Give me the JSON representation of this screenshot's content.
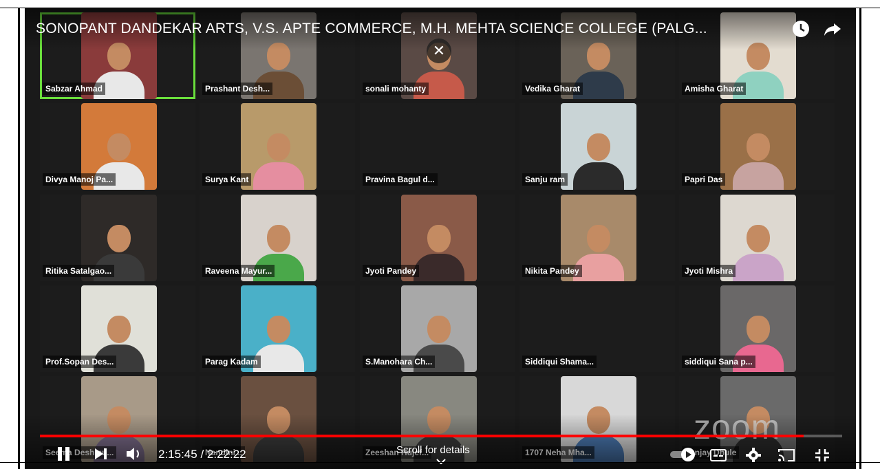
{
  "player": {
    "title": "SONOPANT DANDEKAR ARTS, V.S. APTE COMMERCE, M.H. MEHTA SCIENCE COLLEGE (PALG...",
    "clock_icon": "clock-icon",
    "share_icon": "share-icon",
    "close_icon": "close-icon",
    "watermark": "zoom"
  },
  "participants": [
    {
      "name": "Sabzar Ahmad",
      "active": true,
      "bg": "#8a3b3b",
      "shirt": "#e8e8e8"
    },
    {
      "name": "Prashant Desh...",
      "bg": "#7a7570",
      "shirt": "#6b4e36"
    },
    {
      "name": "sonali mohanty",
      "bg": "#5a4a45",
      "shirt": "#c65a4a"
    },
    {
      "name": "Vedika Gharat",
      "bg": "#6a6258",
      "shirt": "#2e3b4a"
    },
    {
      "name": "Amisha Gharat",
      "bg": "#e3dcd0",
      "shirt": "#8fd1c0"
    },
    {
      "name": "Divya Manoj Pa...",
      "bg": "#d37a3a",
      "shirt": "#e8e8e8"
    },
    {
      "name": "Surya Kant",
      "bg": "#b89a6a",
      "shirt": "#e58ea0"
    },
    {
      "name": "Pravina Bagul d...",
      "bg": "#1c1c1c",
      "shirt": "#1c1c1c"
    },
    {
      "name": "Sanju ram",
      "bg": "#c9d4d6",
      "shirt": "#2b2b2b"
    },
    {
      "name": "Papri Das",
      "bg": "#9a7048",
      "shirt": "#c7a3a0"
    },
    {
      "name": "Ritika Satalgao...",
      "bg": "#2e2a28",
      "shirt": "#3a3a3a"
    },
    {
      "name": "Raveena Mayur...",
      "bg": "#d8d2cc",
      "shirt": "#4aa84a"
    },
    {
      "name": "Jyoti Pandey",
      "bg": "#8a5a48",
      "shirt": "#3a2a2a"
    },
    {
      "name": "Nikita Pandey",
      "bg": "#a88a6a",
      "shirt": "#e8a0a0"
    },
    {
      "name": "Jyoti Mishra",
      "bg": "#ddd8d0",
      "shirt": "#caa4c8"
    },
    {
      "name": "Prof.Sopan Des...",
      "bg": "#e0e0d8",
      "shirt": "#3a3a3a"
    },
    {
      "name": "Parag Kadam",
      "bg": "#4ab0c8",
      "shirt": "#e8e8e8"
    },
    {
      "name": "S.Manohara Ch...",
      "bg": "#a8a8a8",
      "shirt": "#4a4a4a"
    },
    {
      "name": "Siddiqui Shama...",
      "bg": "#1c1c1c",
      "shirt": "#1c1c1c"
    },
    {
      "name": "siddiqui Sana p...",
      "bg": "#6a6868",
      "shirt": "#e86890"
    },
    {
      "name": "Seema Deshmu...",
      "bg": "#a89a88",
      "shirt": "#7a6a88"
    },
    {
      "name": "Nandini...",
      "bg": "#6a5040",
      "shirt": "#3a3a3a"
    },
    {
      "name": "Zeeshan Hujef...",
      "bg": "#888880",
      "shirt": "#3a3a3a"
    },
    {
      "name": "1707 Neha Mha...",
      "bg": "#d8d8d8",
      "shirt": "#4a78b0"
    },
    {
      "name": "Sanjay Dhule",
      "bg": "#6a6a6a",
      "shirt": "#2a2a2a"
    }
  ],
  "controls": {
    "current_time": "2:15:45",
    "duration": "2:22:22",
    "time_sep": " / ",
    "progress_fraction": 0.952,
    "scroll_hint": "Scroll for details",
    "play_pause_icon": "pause-icon",
    "next_icon": "next-icon",
    "volume_icon": "volume-icon",
    "autoplay_icon": "autoplay-toggle-icon",
    "subtitles_icon": "subtitles-icon",
    "settings_icon": "gear-icon",
    "cast_icon": "cast-icon",
    "fullscreen_icon": "exit-fullscreen-icon"
  }
}
